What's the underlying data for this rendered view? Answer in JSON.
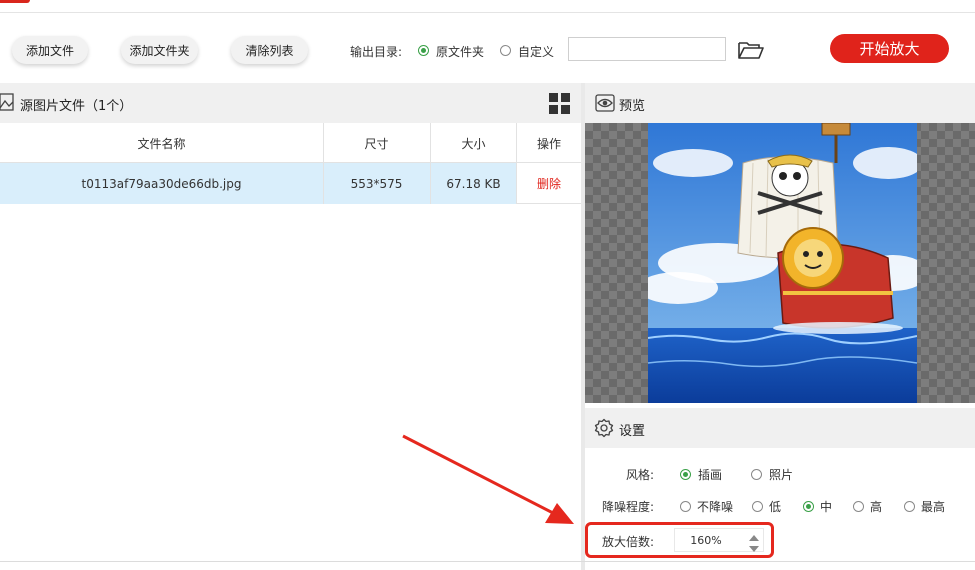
{
  "toolbar": {
    "add_file": "添加文件",
    "add_folder": "添加文件夹",
    "clear_list": "清除列表",
    "output_dir_label": "输出目录:",
    "output_options": [
      "原文件夹",
      "自定义"
    ],
    "output_selected": "原文件夹",
    "custom_path_value": "",
    "start_button": "开始放大"
  },
  "file_panel": {
    "title": "源图片文件（1个）",
    "columns": [
      "文件名称",
      "尺寸",
      "大小",
      "操作"
    ],
    "rows": [
      {
        "name": "t0113af79aa30de66db.jpg",
        "size": "553*575",
        "filesize": "67.18 KB",
        "action": "删除"
      }
    ]
  },
  "preview": {
    "title": "预览"
  },
  "settings": {
    "title": "设置",
    "style_label": "风格:",
    "style_options": [
      "插画",
      "照片"
    ],
    "style_selected": "插画",
    "noise_label": "降噪程度:",
    "noise_options": [
      "不降噪",
      "低",
      "中",
      "高",
      "最高"
    ],
    "noise_selected": "中",
    "scale_label": "放大倍数:",
    "scale_value": "160%"
  },
  "colors": {
    "accent_red": "#e0231b",
    "radio_green": "#3aa048",
    "selected_row": "#d9eefb",
    "delete_red": "#e0231b"
  },
  "icons": {
    "folder": "folder-open-icon",
    "grid": "grid-view-icon",
    "image": "image-icon",
    "preview": "eye-icon",
    "settings": "gear-icon",
    "stepper_up": "triangle-up-icon",
    "stepper_down": "triangle-down-icon"
  }
}
